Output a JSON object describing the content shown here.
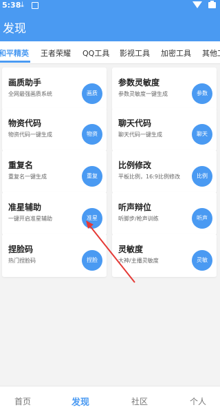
{
  "status": {
    "time": "5:38"
  },
  "header": {
    "title": "发现"
  },
  "tabs": [
    {
      "label": "和平精英",
      "active": true
    },
    {
      "label": "王者荣耀"
    },
    {
      "label": "QQ工具"
    },
    {
      "label": "影视工具"
    },
    {
      "label": "加密工具"
    },
    {
      "label": "其他工"
    }
  ],
  "cards": [
    {
      "title": "画质助手",
      "subtitle": "全网最强画质系统",
      "button": "画质"
    },
    {
      "title": "参数灵敏度",
      "subtitle": "参数灵敏度一键生成",
      "button": "参数"
    },
    {
      "title": "物资代码",
      "subtitle": "物资代码一键生成",
      "button": "物资"
    },
    {
      "title": "聊天代码",
      "subtitle": "聊天代码一键生成",
      "button": "聊天"
    },
    {
      "title": "重复名",
      "subtitle": "重复名一键生成",
      "button": "重复"
    },
    {
      "title": "比例修改",
      "subtitle": "平板比例，16:9比例修改",
      "button": "比例"
    },
    {
      "title": "准星辅助",
      "subtitle": "一键开启准星辅助",
      "button": "准星"
    },
    {
      "title": "听声辩位",
      "subtitle": "听脚步/枪声训练",
      "button": "听声"
    },
    {
      "title": "捏脸码",
      "subtitle": "热门捏脸码",
      "button": "捏脸"
    },
    {
      "title": "灵敏度",
      "subtitle": "大神/主播灵敏度",
      "button": "灵敏"
    }
  ],
  "bottom_nav": [
    {
      "label": "首页"
    },
    {
      "label": "发现",
      "active": true
    },
    {
      "label": "社区"
    },
    {
      "label": "个人"
    }
  ],
  "colors": {
    "accent": "#4a9af2",
    "arrow": "#e53935"
  }
}
